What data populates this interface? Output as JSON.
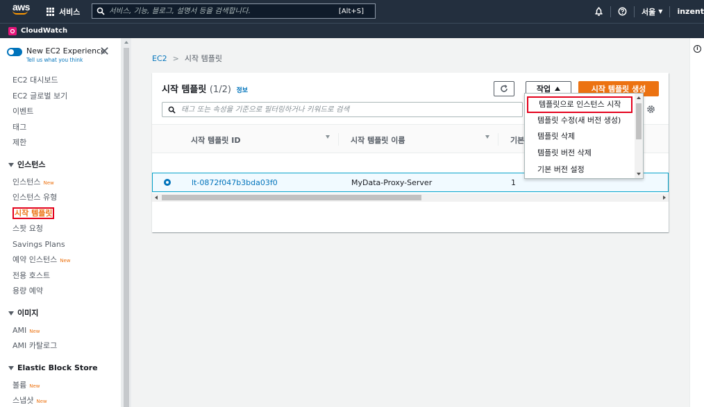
{
  "topnav": {
    "logo_text": "aws",
    "services_label": "서비스",
    "search_placeholder": "서비스, 기능, 블로그, 설명서 등을 검색합니다.",
    "search_shortcut": "[Alt+S]",
    "region_label": "서울",
    "account_label": "inzent"
  },
  "favorites": {
    "cloudwatch_label": "CloudWatch"
  },
  "sidebar": {
    "toggle_title": "New EC2 Experience",
    "toggle_subtitle": "Tell us what you think",
    "top_items": [
      {
        "label": "EC2 대시보드"
      },
      {
        "label": "EC2 글로벌 보기"
      },
      {
        "label": "이벤트"
      },
      {
        "label": "태그"
      },
      {
        "label": "제한"
      }
    ],
    "instances_section": "인스턴스",
    "instance_items": [
      {
        "label": "인스턴스",
        "badge": "New"
      },
      {
        "label": "인스턴스 유형",
        "badge": ""
      },
      {
        "label": "시작 템플릿",
        "badge": ""
      },
      {
        "label": "스팟 요청",
        "badge": ""
      },
      {
        "label": "Savings Plans",
        "badge": ""
      },
      {
        "label": "예약 인스턴스",
        "badge": "New"
      },
      {
        "label": "전용 호스트",
        "badge": ""
      },
      {
        "label": "용량 예약",
        "badge": ""
      }
    ],
    "images_section": "이미지",
    "image_items": [
      {
        "label": "AMI",
        "badge": "New"
      },
      {
        "label": "AMI 카탈로그",
        "badge": ""
      }
    ],
    "ebs_section": "Elastic Block Store",
    "ebs_items": [
      {
        "label": "볼륨",
        "badge": "New"
      },
      {
        "label": "스냅샷",
        "badge": "New"
      }
    ]
  },
  "breadcrumb": {
    "root": "EC2",
    "separator": ">",
    "current": "시작 템플릿"
  },
  "panel": {
    "title": "시작 템플릿",
    "count": "(1/2)",
    "info_link": "정보",
    "actions_label": "작업",
    "create_label": "시작 템플릿 생성",
    "filter_placeholder": "태그 또는 속성을 기준으로 필터링하거나 키워드로 검색"
  },
  "table": {
    "columns": [
      "시작 템플릿 ID",
      "시작 템플릿 이름",
      "기본"
    ],
    "rows": [
      {
        "id": "lt-0872f047b3bda03f0",
        "name": "MyData-Proxy-Server",
        "version": "1"
      }
    ]
  },
  "actions_menu": {
    "items": [
      {
        "label": "템플릿으로 인스턴스 시작"
      },
      {
        "label": "템플릿 수정(새 버전 생성)"
      },
      {
        "label": "템플릿 삭제"
      },
      {
        "label": "템플릿 버전 삭제"
      },
      {
        "label": "기본 버전 설정"
      }
    ]
  },
  "right_rail": {
    "info_glyph": "i"
  },
  "colors": {
    "nav_bg": "#232f3e",
    "accent_orange": "#ec7211",
    "link_blue": "#0073bb",
    "highlight_red": "#e3001b"
  }
}
